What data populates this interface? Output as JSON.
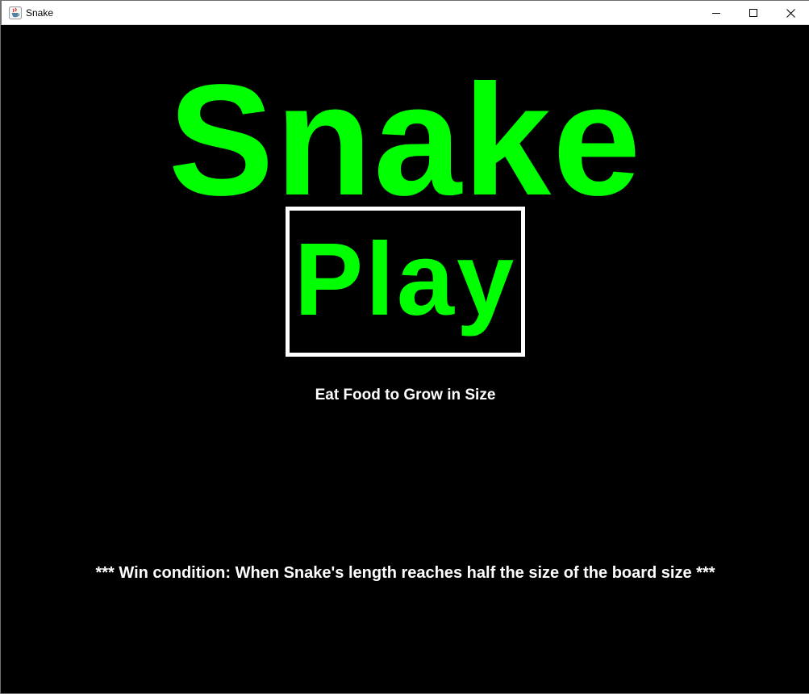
{
  "window": {
    "title": "Snake",
    "app_icon": "java-cup-icon",
    "controls": {
      "minimize_icon": "minimize-icon",
      "maximize_icon": "maximize-icon",
      "close_icon": "close-icon"
    }
  },
  "game": {
    "title": "Snake",
    "play_label": "Play",
    "instruction": "Eat Food to Grow in Size",
    "win_condition": "*** Win condition: When Snake's length reaches half the size of the board size ***",
    "colors": {
      "background": "#000000",
      "accent": "#00ff00",
      "text": "#ffffff",
      "button_border": "#ffffff"
    }
  }
}
